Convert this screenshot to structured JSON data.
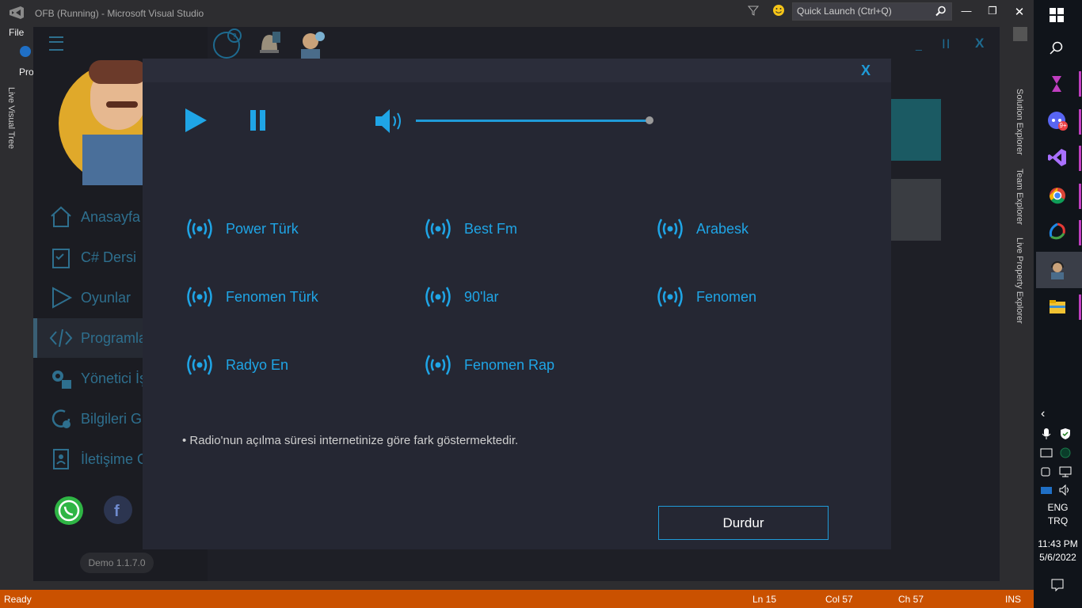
{
  "vs": {
    "title": "OFB (Running) - Microsoft Visual Studio",
    "quick_launch_placeholder": "Quick Launch (Ctrl+Q)",
    "menu_file": "File",
    "menu_pro": "Pro",
    "live_visual_tree": "Live Visual Tree",
    "right_panels": [
      "Solution Explorer",
      "Team Explorer",
      "Live Property Explorer"
    ],
    "status": {
      "ready": "Ready",
      "ln": "Ln 15",
      "col": "Col 57",
      "ch": "Ch 57",
      "ins": "INS"
    }
  },
  "app": {
    "nav": [
      {
        "label": "Anasayfa",
        "icon": "home-icon"
      },
      {
        "label": "C# Dersi",
        "icon": "clipboard-icon"
      },
      {
        "label": "Oyunlar",
        "icon": "play-triangle-icon"
      },
      {
        "label": "Programla",
        "icon": "code-icon"
      },
      {
        "label": "Yönetici İş",
        "icon": "gears-icon"
      },
      {
        "label": "Bilgileri G",
        "icon": "refresh-gear-icon"
      },
      {
        "label": "İletişime G",
        "icon": "contact-book-icon"
      }
    ],
    "version": "Demo 1.1.7.0",
    "header_window_buttons": [
      "_",
      "II",
      "X"
    ]
  },
  "modal": {
    "close_label": "X",
    "volume_fraction": 1.0,
    "stations": [
      "Power Türk",
      "Best Fm",
      "Arabesk",
      "Fenomen Türk",
      "90'lar",
      "Fenomen",
      "Radyo En",
      "Fenomen Rap"
    ],
    "note": "• Radio'nun açılma süresi internetinize göre fark göstermektedir.",
    "stop_label": "Durdur"
  },
  "taskbar": {
    "lang_1": "ENG",
    "lang_2": "TRQ",
    "time": "11:43 PM",
    "date": "5/6/2022",
    "discord_badge": "9+"
  }
}
